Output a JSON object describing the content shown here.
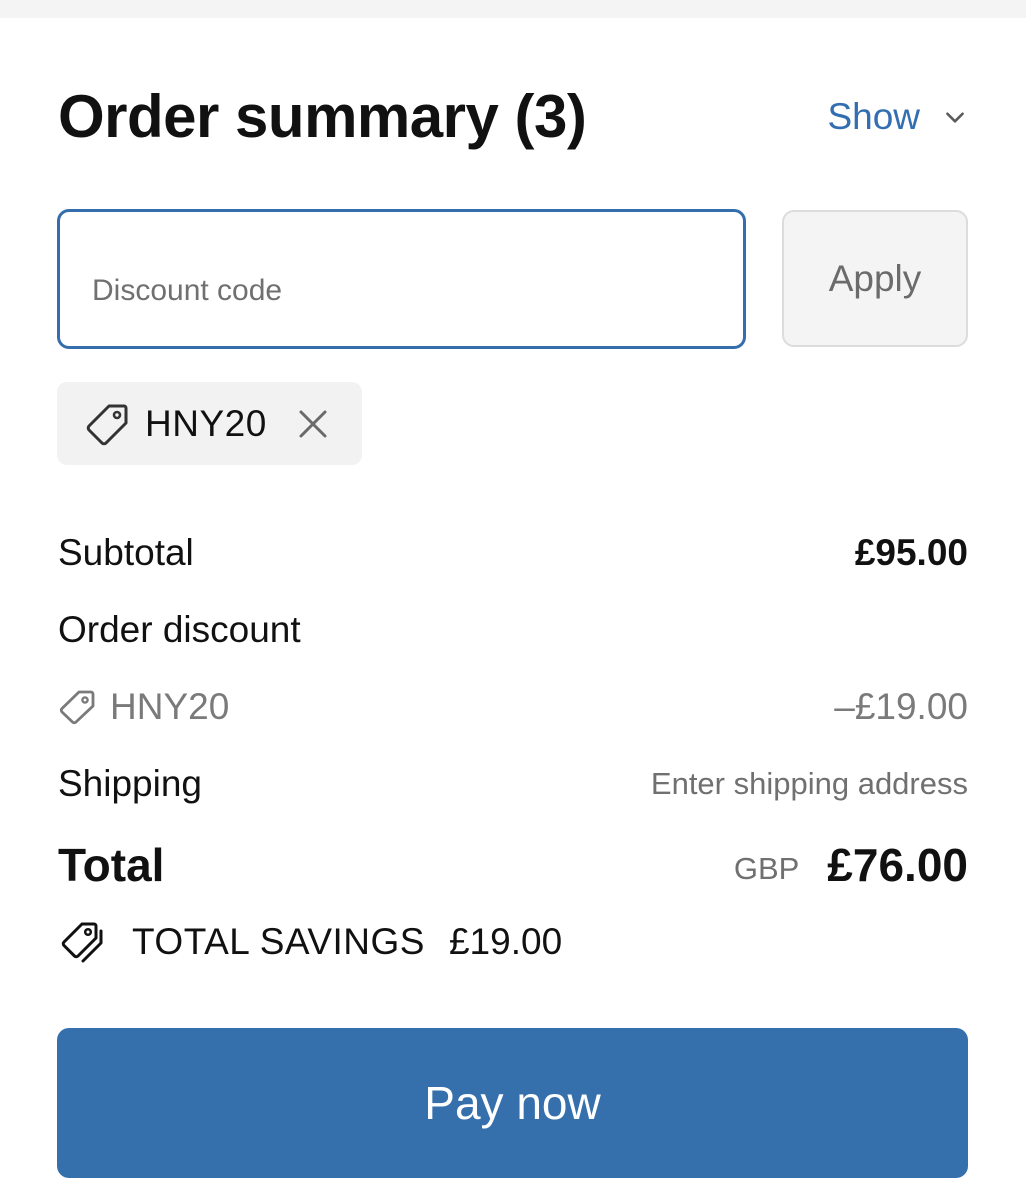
{
  "header": {
    "title": "Order summary (3)",
    "toggle_label": "Show",
    "toggle_icon": "chevron-down-icon"
  },
  "discount": {
    "placeholder": "Discount code",
    "value": "",
    "apply_label": "Apply",
    "applied_code": "HNY20"
  },
  "summary": {
    "subtotal_label": "Subtotal",
    "subtotal_value": "£95.00",
    "order_discount_label": "Order discount",
    "discount_code": "HNY20",
    "discount_value": "–£19.00",
    "shipping_label": "Shipping",
    "shipping_value": "Enter shipping address",
    "total_label": "Total",
    "currency": "GBP",
    "total_value": "£76.00",
    "savings_label": "TOTAL SAVINGS",
    "savings_value": "£19.00"
  },
  "pay_button": {
    "label": "Pay now"
  },
  "colors": {
    "accent": "#3670ac",
    "link": "#336fb0",
    "muted_text": "#707070",
    "chip_background": "#f2f2f2"
  }
}
